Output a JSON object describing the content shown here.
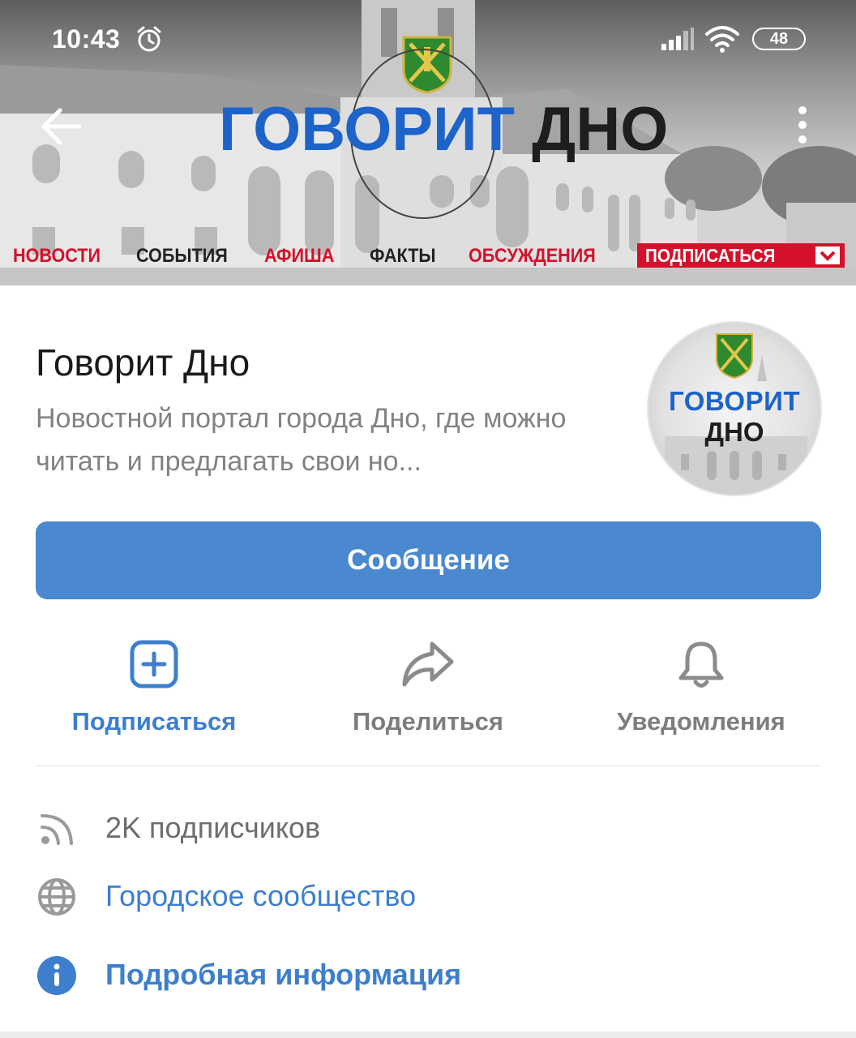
{
  "status_bar": {
    "time": "10:43",
    "battery": "48",
    "icons": [
      "alarm-icon",
      "signal-icon",
      "wifi-icon",
      "battery-icon"
    ]
  },
  "cover": {
    "brand_part1": "ГОВОРИТ",
    "brand_part2": "ДНО",
    "nav": {
      "news": "НОВОСТИ",
      "events": "СОБЫТИЯ",
      "poster": "АФИША",
      "facts": "ФАКТЫ",
      "discussions": "ОБСУЖДЕНИЯ"
    },
    "subscribe_label": "ПОДПИСАТЬСЯ",
    "colors": {
      "brand_blue": "#1d63c9",
      "brand_red": "#d4112a"
    }
  },
  "toolbar": {
    "back_icon": "arrow-left-icon",
    "menu_icon": "more-vertical-icon"
  },
  "profile": {
    "name": "Говорит Дно",
    "description": "Новостной портал города Дно, где можно читать и предлагать свои но...",
    "avatar": {
      "line1": "ГОВОРИТ",
      "line2": "ДНО"
    }
  },
  "message_button": {
    "label": "Сообщение",
    "color": "#4a88cf"
  },
  "actions": {
    "subscribe": {
      "label": "Подписаться",
      "icon": "plus-square-icon"
    },
    "share": {
      "label": "Поделиться",
      "icon": "share-arrow-icon"
    },
    "notifications": {
      "label": "Уведомления",
      "icon": "bell-icon"
    }
  },
  "info": {
    "subscribers": "2K подписчиков",
    "category": "Городское сообщество",
    "details": "Подробная информация"
  },
  "accent_color": "#3d7fcc"
}
